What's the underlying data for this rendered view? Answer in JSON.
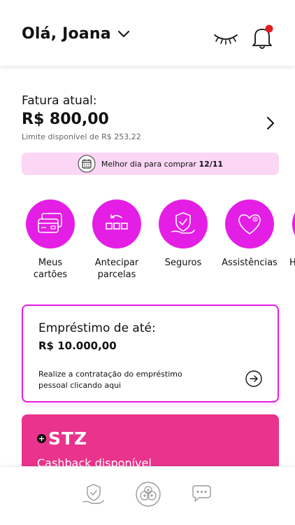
{
  "header": {
    "greeting": "Olá, Joana",
    "icons": [
      "chevron-down-icon",
      "eye-closed-icon",
      "bell-icon"
    ],
    "notification_dot_color": "#e31c1c"
  },
  "invoice": {
    "label": "Fatura atual:",
    "amount": "R$ 800,00",
    "limit": "Limite disponível de R$ 253,22"
  },
  "best_day": {
    "text": "Melhor dia para comprar",
    "date": "12/11",
    "icon": "calendar-icon"
  },
  "shortcuts": [
    {
      "line1": "Meus",
      "line2": "cartões",
      "icon": "cards-icon"
    },
    {
      "line1": "Antecipar",
      "line2": "parcelas",
      "icon": "installments-icon"
    },
    {
      "line1": "Seguros",
      "line2": "",
      "icon": "shield-hand-icon"
    },
    {
      "line1": "Assistências",
      "line2": "",
      "icon": "heart-icon"
    },
    {
      "line1": "H",
      "line2": "",
      "icon": "partial-icon"
    }
  ],
  "loan": {
    "title": "Empréstimo de até:",
    "amount": "R$ 10.000,00",
    "description": "Realize a contratação do empréstimo pessoal clicando aqui"
  },
  "stz": {
    "plus": "+",
    "brand": "STZ",
    "cashback": "Cashback disponível"
  },
  "bottom_nav": [
    "shield-hand-icon",
    "plus-cluster-icon",
    "chat-icon"
  ],
  "colors": {
    "accent": "#e41ee4",
    "accent_light": "#fbd6f5",
    "stz_pink": "#e9338c"
  }
}
